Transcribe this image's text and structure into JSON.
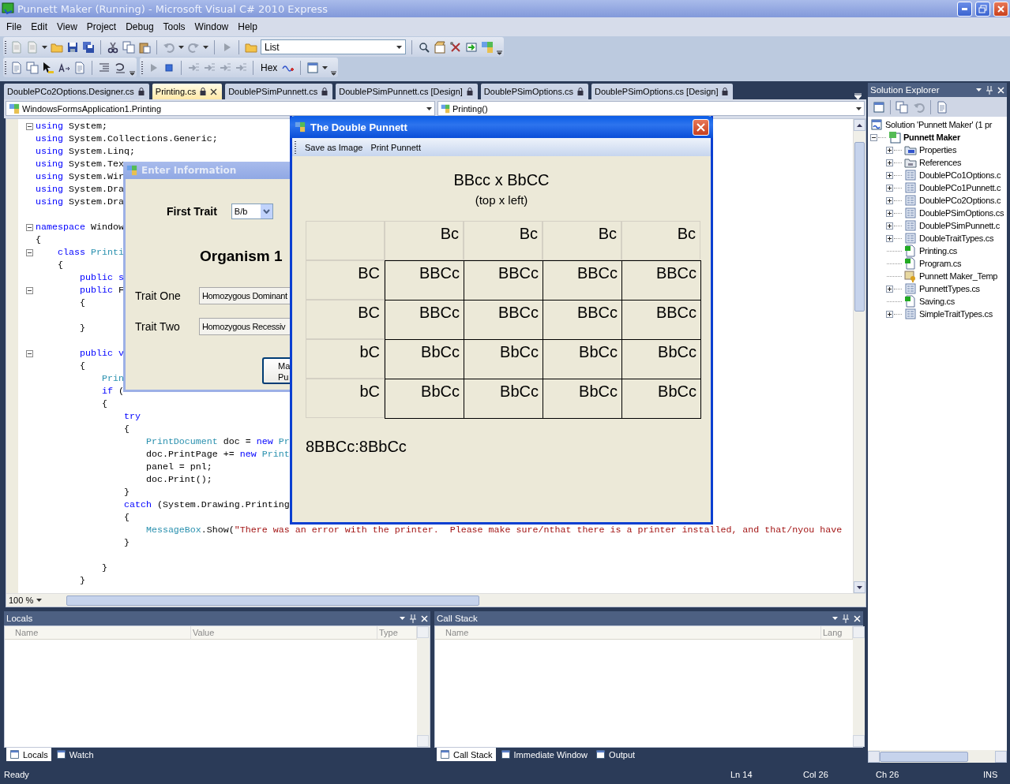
{
  "window": {
    "title": "Punnett Maker (Running) - Microsoft Visual C# 2010 Express"
  },
  "menu": [
    "File",
    "Edit",
    "View",
    "Project",
    "Debug",
    "Tools",
    "Window",
    "Help"
  ],
  "toolbar": {
    "solution_config": "List",
    "hex_button": "Hex"
  },
  "document_tabs": [
    {
      "label": "DoublePCo2Options.Designer.cs",
      "selected": false
    },
    {
      "label": "Printing.cs",
      "selected": true
    },
    {
      "label": "DoublePSimPunnett.cs",
      "selected": false
    },
    {
      "label": "DoublePSimPunnett.cs [Design]",
      "selected": false
    },
    {
      "label": "DoublePSimOptions.cs",
      "selected": false
    },
    {
      "label": "DoublePSimOptions.cs [Design]",
      "selected": false
    }
  ],
  "navigation_bar": {
    "type": "WindowsFormsApplication1.Printing",
    "member": "Printing()"
  },
  "editor": {
    "zoom": "100 %",
    "lines": [
      {
        "kind": "code",
        "fold": true,
        "segs": [
          {
            "kind": "keyword",
            "text": "using"
          },
          {
            "kind": "plain",
            "text": " System;"
          }
        ]
      },
      {
        "kind": "code",
        "fold": false,
        "segs": [
          {
            "kind": "keyword",
            "text": "using"
          },
          {
            "kind": "plain",
            "text": " System.Collections.Generic;"
          }
        ]
      },
      {
        "kind": "code",
        "fold": false,
        "segs": [
          {
            "kind": "keyword",
            "text": "using"
          },
          {
            "kind": "plain",
            "text": " System.Linq;"
          }
        ]
      },
      {
        "kind": "code",
        "fold": false,
        "segs": [
          {
            "kind": "keyword",
            "text": "using"
          },
          {
            "kind": "plain",
            "text": " System.Tex"
          }
        ]
      },
      {
        "kind": "code",
        "fold": false,
        "segs": [
          {
            "kind": "keyword",
            "text": "using"
          },
          {
            "kind": "plain",
            "text": " System.Wir"
          }
        ]
      },
      {
        "kind": "code",
        "fold": false,
        "segs": [
          {
            "kind": "keyword",
            "text": "using"
          },
          {
            "kind": "plain",
            "text": " System.Dra"
          }
        ]
      },
      {
        "kind": "code",
        "fold": false,
        "segs": [
          {
            "kind": "keyword",
            "text": "using"
          },
          {
            "kind": "plain",
            "text": " System.Dra"
          }
        ]
      },
      {
        "kind": "blank"
      },
      {
        "kind": "code",
        "fold": true,
        "segs": [
          {
            "kind": "keyword",
            "text": "namespace"
          },
          {
            "kind": "plain",
            "text": " Window"
          }
        ]
      },
      {
        "kind": "code",
        "fold": false,
        "segs": [
          {
            "kind": "plain",
            "text": "{"
          }
        ]
      },
      {
        "kind": "code",
        "fold": true,
        "segs": [
          {
            "kind": "keyword",
            "text": "    class"
          },
          {
            "kind": "type",
            "text": " Printi"
          }
        ]
      },
      {
        "kind": "code",
        "fold": false,
        "segs": [
          {
            "kind": "plain",
            "text": "    {"
          }
        ]
      },
      {
        "kind": "code",
        "fold": false,
        "segs": [
          {
            "kind": "keyword",
            "text": "        public s"
          }
        ]
      },
      {
        "kind": "code",
        "fold": true,
        "segs": [
          {
            "kind": "keyword",
            "text": "        public"
          },
          {
            "kind": "plain",
            "text": " F"
          }
        ]
      },
      {
        "kind": "code",
        "fold": false,
        "segs": [
          {
            "kind": "plain",
            "text": "        {"
          }
        ]
      },
      {
        "kind": "blank"
      },
      {
        "kind": "code",
        "fold": false,
        "segs": [
          {
            "kind": "plain",
            "text": "        }"
          }
        ]
      },
      {
        "kind": "blank"
      },
      {
        "kind": "code",
        "fold": true,
        "segs": [
          {
            "kind": "keyword",
            "text": "        public v"
          }
        ]
      },
      {
        "kind": "code",
        "fold": false,
        "segs": [
          {
            "kind": "plain",
            "text": "        {"
          }
        ]
      },
      {
        "kind": "code",
        "fold": false,
        "segs": [
          {
            "kind": "type",
            "text": "            Prin"
          }
        ]
      },
      {
        "kind": "code",
        "fold": false,
        "segs": [
          {
            "kind": "keyword",
            "text": "            if"
          },
          {
            "kind": "plain",
            "text": " ("
          }
        ]
      },
      {
        "kind": "code",
        "fold": false,
        "segs": [
          {
            "kind": "plain",
            "text": "            {"
          }
        ]
      },
      {
        "kind": "code",
        "fold": false,
        "segs": [
          {
            "kind": "keyword",
            "text": "                try"
          }
        ]
      },
      {
        "kind": "code",
        "fold": false,
        "segs": [
          {
            "kind": "plain",
            "text": "                {"
          }
        ]
      },
      {
        "kind": "code",
        "fold": false,
        "segs": [
          {
            "kind": "type",
            "text": "                    PrintDocument"
          },
          {
            "kind": "plain",
            "text": " doc = "
          },
          {
            "kind": "keyword",
            "text": "new"
          },
          {
            "kind": "type",
            "text": " Pr"
          }
        ]
      },
      {
        "kind": "code",
        "fold": false,
        "segs": [
          {
            "kind": "plain",
            "text": "                    doc.PrintPage += "
          },
          {
            "kind": "keyword",
            "text": "new"
          },
          {
            "kind": "type",
            "text": " Print"
          }
        ]
      },
      {
        "kind": "code",
        "fold": false,
        "segs": [
          {
            "kind": "plain",
            "text": "                    panel = pnl;"
          }
        ]
      },
      {
        "kind": "code",
        "fold": false,
        "segs": [
          {
            "kind": "plain",
            "text": "                    doc.Print();"
          }
        ]
      },
      {
        "kind": "code",
        "fold": false,
        "segs": [
          {
            "kind": "plain",
            "text": "                }"
          }
        ]
      },
      {
        "kind": "code",
        "fold": false,
        "segs": [
          {
            "kind": "keyword",
            "text": "                catch"
          },
          {
            "kind": "plain",
            "text": " (System.Drawing.Printing"
          }
        ]
      },
      {
        "kind": "code",
        "fold": false,
        "segs": [
          {
            "kind": "plain",
            "text": "                {"
          }
        ]
      },
      {
        "kind": "code",
        "fold": false,
        "segs": [
          {
            "kind": "type",
            "text": "                    MessageBox"
          },
          {
            "kind": "plain",
            "text": ".Show("
          },
          {
            "kind": "string",
            "text": "\"There was an error with the printer.  Please make sure/nthat there is a printer installed, and that/nyou have"
          }
        ]
      },
      {
        "kind": "code",
        "fold": false,
        "segs": [
          {
            "kind": "plain",
            "text": "                }"
          }
        ]
      },
      {
        "kind": "blank"
      },
      {
        "kind": "code",
        "fold": false,
        "segs": [
          {
            "kind": "plain",
            "text": "            }"
          }
        ]
      },
      {
        "kind": "code",
        "fold": false,
        "segs": [
          {
            "kind": "plain",
            "text": "        }"
          }
        ]
      }
    ]
  },
  "solution_explorer": {
    "title": "Solution Explorer",
    "tree": [
      {
        "label": "Solution 'Punnett Maker' (1 pr",
        "kind": "solution",
        "children": [
          {
            "label": "Punnett Maker",
            "kind": "project",
            "expanded": true,
            "children": [
              {
                "label": "Properties",
                "kind": "properties",
                "expanded": false
              },
              {
                "label": "References",
                "kind": "references",
                "expanded": false
              },
              {
                "label": "DoublePCo1Options.c",
                "kind": "form",
                "expanded": false
              },
              {
                "label": "DoublePCo1Punnett.c",
                "kind": "form",
                "expanded": false
              },
              {
                "label": "DoublePCo2Options.c",
                "kind": "form",
                "expanded": false
              },
              {
                "label": "DoublePSimOptions.cs",
                "kind": "form",
                "expanded": false
              },
              {
                "label": "DoublePSimPunnett.c",
                "kind": "form",
                "expanded": false
              },
              {
                "label": "DoubleTraitTypes.cs",
                "kind": "form",
                "expanded": false
              },
              {
                "label": "Printing.cs",
                "kind": "code"
              },
              {
                "label": "Program.cs",
                "kind": "code"
              },
              {
                "label": "Punnett Maker_Temp",
                "kind": "key"
              },
              {
                "label": "PunnettTypes.cs",
                "kind": "form",
                "expanded": false
              },
              {
                "label": "Saving.cs",
                "kind": "code"
              },
              {
                "label": "SimpleTraitTypes.cs",
                "kind": "form",
                "expanded": false
              }
            ]
          }
        ]
      }
    ]
  },
  "locals_panel": {
    "title": "Locals",
    "columns": [
      "Name",
      "Value",
      "Type"
    ],
    "tabs": [
      {
        "label": "Locals",
        "selected": true
      },
      {
        "label": "Watch",
        "selected": false
      }
    ]
  },
  "call_stack_panel": {
    "title": "Call Stack",
    "columns": [
      "Name",
      "Lang"
    ],
    "tabs": [
      {
        "label": "Call Stack",
        "selected": true
      },
      {
        "label": "Immediate Window",
        "selected": false
      },
      {
        "label": "Output",
        "selected": false
      }
    ]
  },
  "status_bar": {
    "message": "Ready",
    "line": "Ln 14",
    "column": "Col 26",
    "character": "Ch 26",
    "mode": "INS"
  },
  "enter_information_dialog": {
    "title": "Enter Information",
    "first_trait_label": "First Trait",
    "first_trait_value": "B/b",
    "heading": "Organism 1",
    "fields": [
      {
        "label": "Trait One",
        "value": "Homozygous Dominant"
      },
      {
        "label": "Trait Two",
        "value": "Homozygous Recessiv"
      }
    ],
    "button": "Ma Pu"
  },
  "punnett_dialog": {
    "title": "The Double Punnett",
    "menu": [
      "Save as Image",
      "Print Punnett"
    ],
    "cross": "BBcc x BbCC",
    "subtitle": "(top x left)",
    "column_headers": [
      "Bc",
      "Bc",
      "Bc",
      "Bc"
    ],
    "rows": [
      {
        "header": "BC",
        "cells": [
          "BBCc",
          "BBCc",
          "BBCc",
          "BBCc"
        ]
      },
      {
        "header": "BC",
        "cells": [
          "BBCc",
          "BBCc",
          "BBCc",
          "BBCc"
        ]
      },
      {
        "header": "bC",
        "cells": [
          "BbCc",
          "BbCc",
          "BbCc",
          "BbCc"
        ]
      },
      {
        "header": "bC",
        "cells": [
          "BbCc",
          "BbCc",
          "BbCc",
          "BbCc"
        ]
      }
    ],
    "ratio": "8BBCc:8BbCc"
  }
}
